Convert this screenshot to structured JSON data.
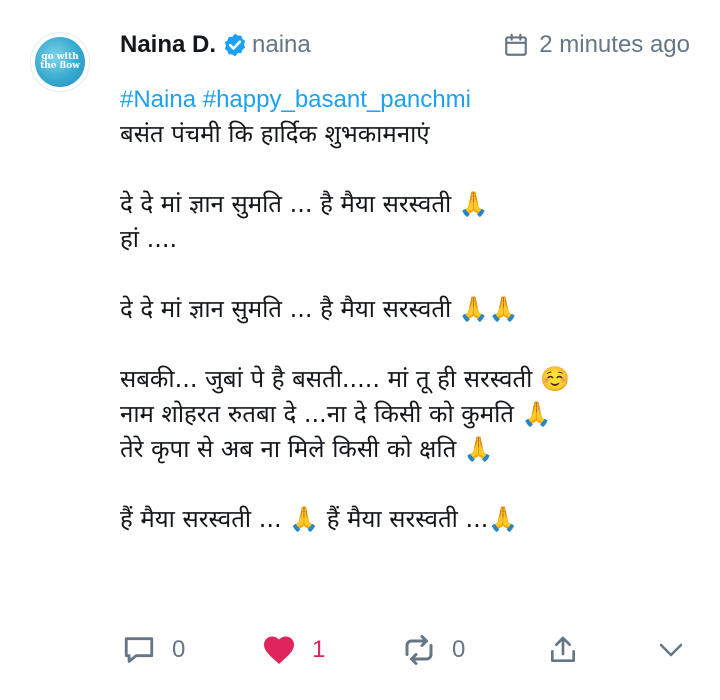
{
  "tweet": {
    "avatar": {
      "text": "go with\nthe flow"
    },
    "display_name": "Naina D.",
    "username": "naina",
    "timestamp": "2 minutes ago",
    "hashtags": [
      "#Naina",
      "#happy_basant_panchmi"
    ],
    "lines": [
      "बसंत पंचमी कि हार्दिक शुभकामनाएं",
      "",
      "दे दे मां ज्ञान सुमति ... है मैया सरस्वती 🙏",
      "हां ....",
      "",
      "दे दे मां ज्ञान सुमति ... है मैया सरस्वती 🙏🙏",
      "",
      "सबकी... जुबां पे है बसती..... मां तू ही सरस्वती ☺️",
      "नाम शोहरत रुतबा दे ...ना दे किसी को कुमति 🙏",
      "तेरे कृपा से अब ना मिले किसी को क्षति 🙏",
      "",
      "हैं मैया सरस्वती ... 🙏 हैं मैया सरस्वती ...🙏"
    ]
  },
  "actions": {
    "reply_count": "0",
    "like_count": "1",
    "retweet_count": "0"
  },
  "colors": {
    "link": "#1da1f2",
    "like": "#e0245e",
    "muted": "#657786"
  }
}
